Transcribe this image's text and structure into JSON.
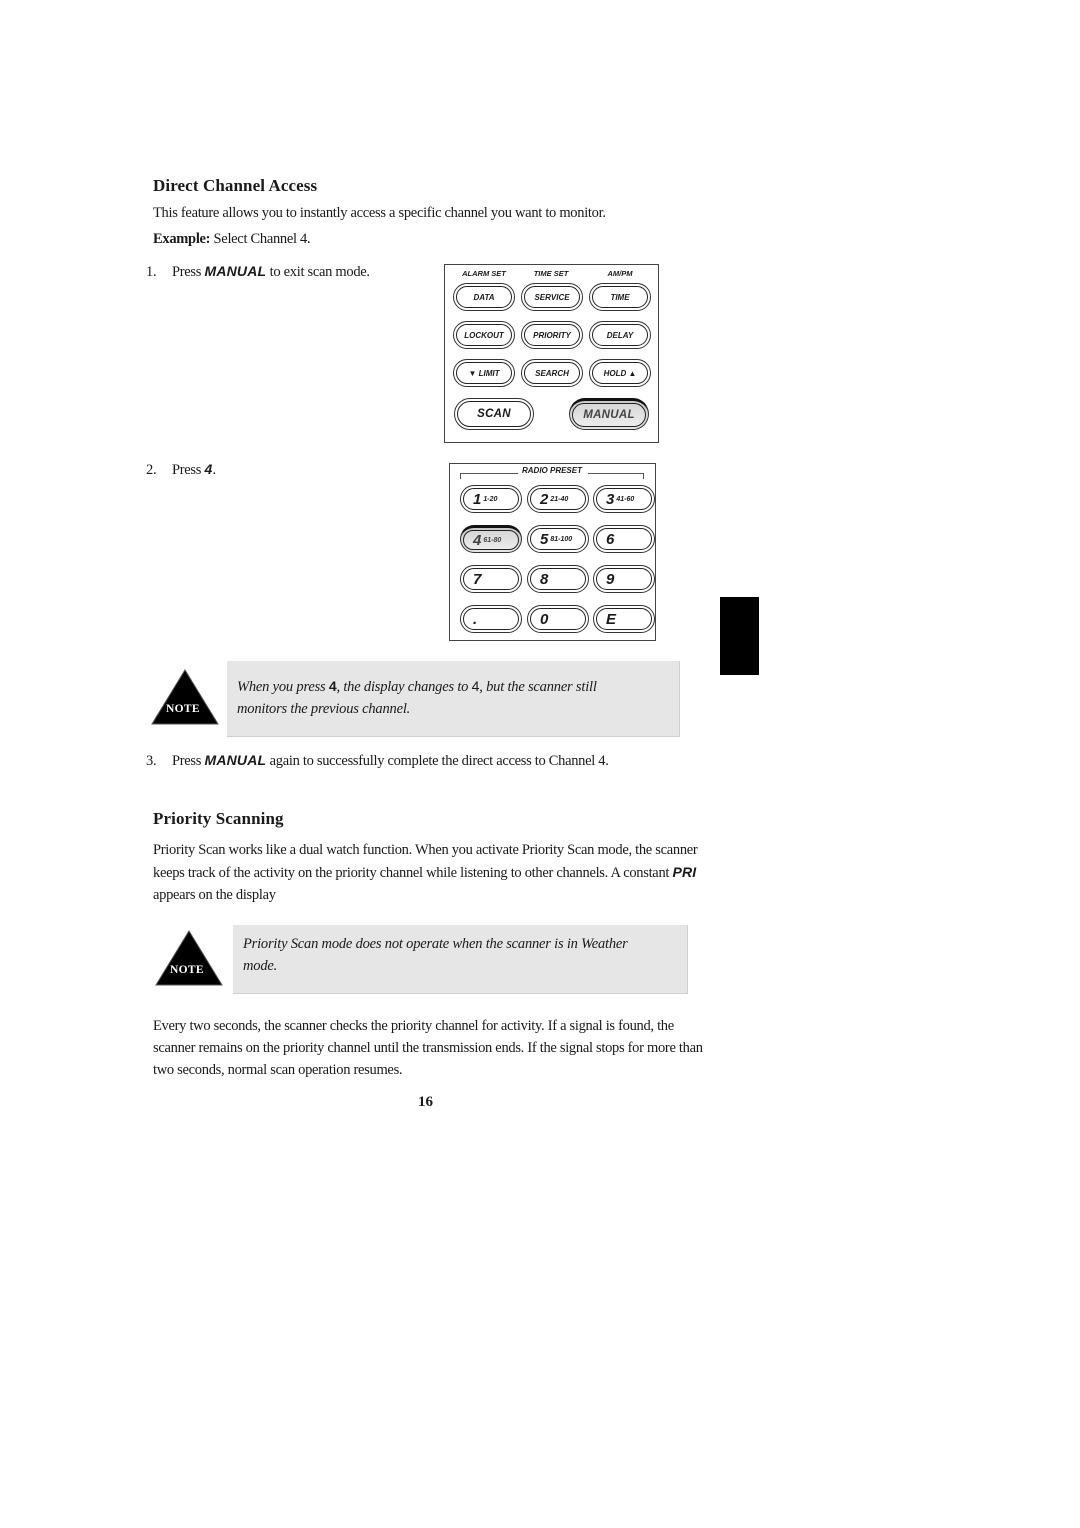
{
  "section1": {
    "heading": "Direct Channel Access",
    "intro": "This feature allows you to instantly access a specific channel you want to monitor.",
    "example_label": "Example:",
    "example_text": " Select Channel 4.",
    "steps": [
      {
        "num": "1.",
        "pre": "Press ",
        "key": "MANUAL",
        "post": " to exit scan mode."
      },
      {
        "num": "2.",
        "pre": "Press ",
        "key": "4",
        "post": "."
      },
      {
        "num": "3.",
        "pre": "Press ",
        "key": "MANUAL",
        "post": " again to successfully complete the direct access to Channel 4."
      }
    ],
    "note": {
      "label": "NOTE",
      "pre": "When you press ",
      "key": "4",
      "mid": ", the display changes to ",
      "plain": "4",
      "post": ", but the scanner still monitors the previous channel."
    }
  },
  "keypad_function": {
    "top_labels": [
      "ALARM SET",
      "TIME SET",
      "AM/PM"
    ],
    "rows": [
      [
        "DATA",
        "SERVICE",
        "TIME"
      ],
      [
        "LOCKOUT",
        "PRIORITY",
        "DELAY"
      ],
      [
        "▼ LIMIT",
        "SEARCH",
        "HOLD ▲"
      ]
    ],
    "scan": "SCAN",
    "manual": "MANUAL",
    "pressed_key": "MANUAL"
  },
  "keypad_preset": {
    "title": "RADIO PRESET",
    "keys": [
      [
        {
          "digit": "1",
          "range": "1-20"
        },
        {
          "digit": "2",
          "range": "21-40"
        },
        {
          "digit": "3",
          "range": "41-60"
        }
      ],
      [
        {
          "digit": "4",
          "range": "61-80"
        },
        {
          "digit": "5",
          "range": "81-100"
        },
        {
          "digit": "6",
          "range": ""
        }
      ],
      [
        {
          "digit": "7",
          "range": ""
        },
        {
          "digit": "8",
          "range": ""
        },
        {
          "digit": "9",
          "range": ""
        }
      ],
      [
        {
          "digit": ".",
          "range": ""
        },
        {
          "digit": "0",
          "range": ""
        },
        {
          "digit": "E",
          "range": ""
        }
      ]
    ],
    "pressed_key": "4"
  },
  "section2": {
    "heading": "Priority Scanning",
    "para1_pre": "Priority Scan works like a dual watch function. When you activate Priority Scan mode, the scanner keeps track of the activity on the priority channel while listening to other channels. A constant ",
    "para1_key": "PRI",
    "para1_post": " appears on the display",
    "note": {
      "label": "NOTE",
      "text": "Priority Scan mode does not operate when the scanner is in Weather mode."
    },
    "para2": "Every two seconds, the scanner checks the priority channel for activity. If a signal is found, the scanner remains on the priority channel until the transmission ends. If the signal stops for more than two seconds, normal scan operation resumes."
  },
  "page_number": "16"
}
